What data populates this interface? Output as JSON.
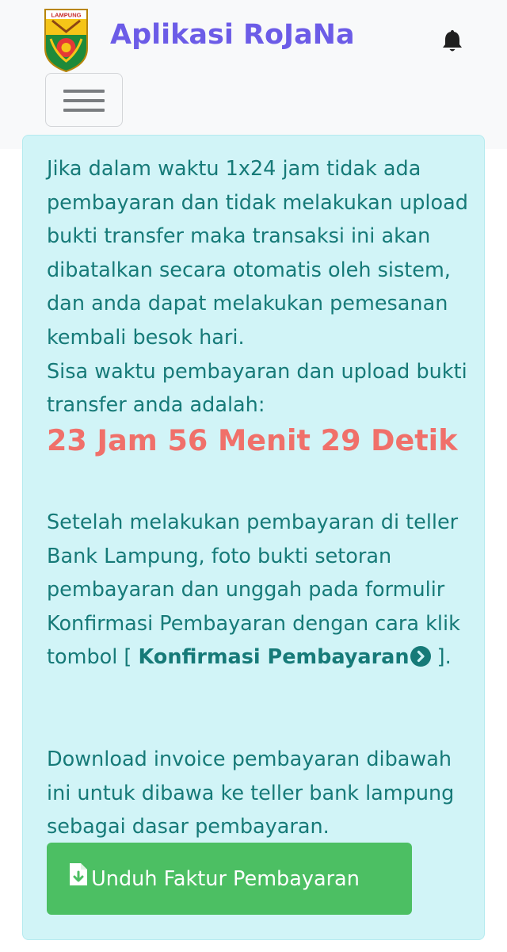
{
  "header": {
    "logo_text": "LAMPUNG",
    "brand": "Aplikasi RoJaNa",
    "icons": {
      "notification": "bell-icon",
      "menu": "hamburger-icon"
    }
  },
  "alert": {
    "paragraph1": "Jika dalam waktu 1x24 jam tidak ada pembayaran dan tidak melakukan upload bukti transfer maka transaksi ini akan dibatalkan secara otomatis oleh sistem, dan anda dapat melakukan pemesanan kembali besok hari.",
    "paragraph2": "Sisa waktu pembayaran dan upload bukti transfer anda adalah:",
    "countdown": "23 Jam 56 Menit 29 Detik",
    "paragraph3_before": "Setelah melakukan pembayaran di teller Bank Lampung, foto bukti setoran pembayaran dan unggah pada formulir Konfirmasi Pembayaran dengan cara klik tombol [ ",
    "paragraph3_link": "Konfirmasi Pembayaran",
    "paragraph3_after": " ].",
    "paragraph4": "Download invoice pembayaran dibawah ini untuk dibawa ke teller bank lampung sebagai dasar pembayaran.",
    "download_button": "Unduh Faktur Pembayaran"
  },
  "colors": {
    "brand": "#6c5ce7",
    "alert_bg": "#d1f4f7",
    "alert_text": "#167a78",
    "countdown": "#f0706a",
    "button_bg": "#4cbf63"
  }
}
